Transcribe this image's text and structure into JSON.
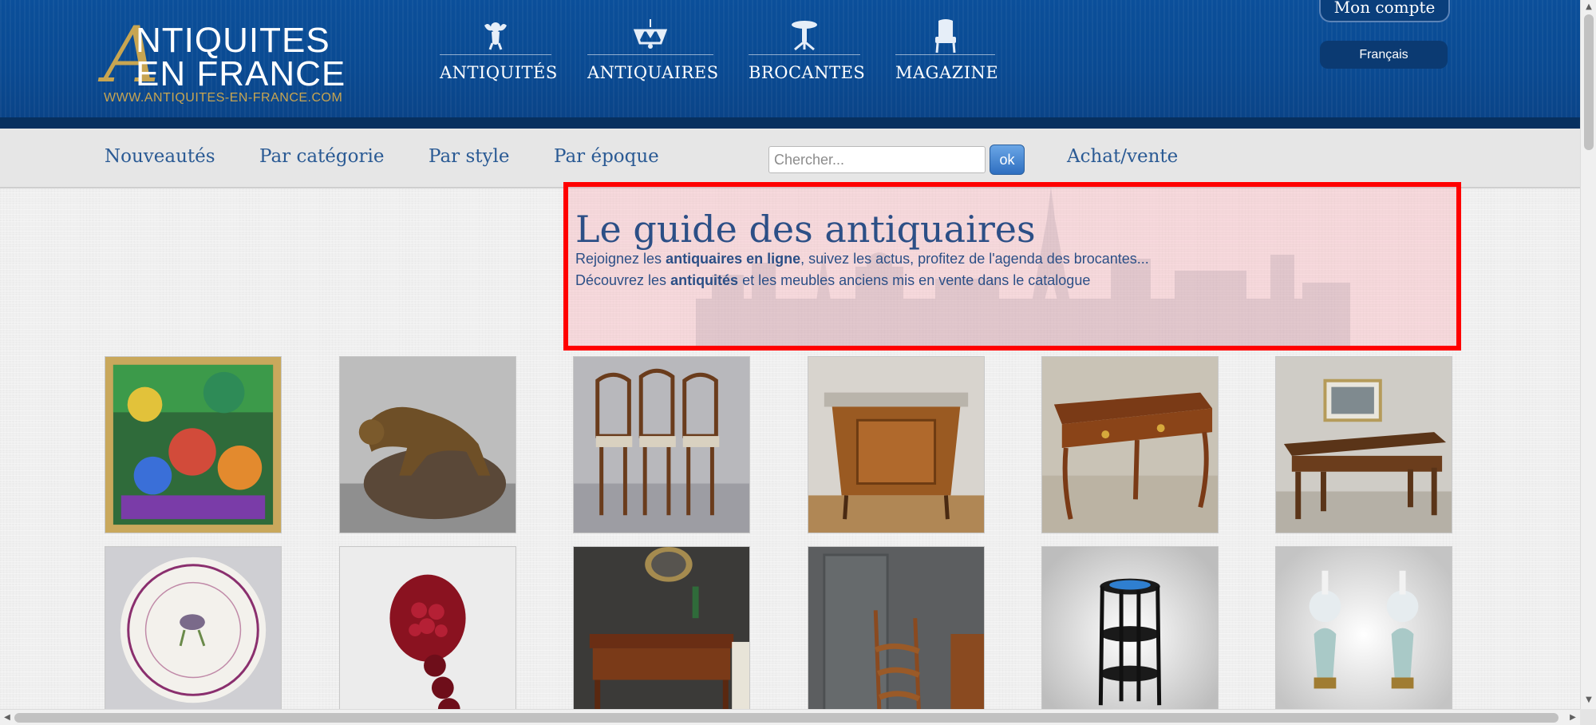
{
  "logo": {
    "big_letter": "A",
    "line1": "NTIQUITES",
    "line2": "EN FRANCE",
    "url": "WWW.ANTIQUITES-EN-FRANCE.COM"
  },
  "main_nav": [
    {
      "label": "ANTIQUITÉS",
      "icon": "cherub-icon"
    },
    {
      "label": "ANTIQUAIRES",
      "icon": "chandelier-icon"
    },
    {
      "label": "BROCANTES",
      "icon": "gueridon-table-icon"
    },
    {
      "label": "MAGAZINE",
      "icon": "armchair-icon"
    }
  ],
  "account": {
    "label": "Mon compte",
    "language": "Français"
  },
  "subnav": {
    "links": [
      "Nouveautés",
      "Par catégorie",
      "Par style",
      "Par époque"
    ],
    "search_placeholder": "Chercher...",
    "search_button": "ok",
    "buy_sell": "Achat/vente"
  },
  "intro": {
    "title": "Le guide des antiquaires",
    "line1_a": "Rejoignez les ",
    "line1_b": "antiquaires en ligne",
    "line1_c": ", suivez les actus, profitez de l'agenda des brocantes...",
    "line2_a": "Découvrez les ",
    "line2_b": "antiquités",
    "line2_c": " et les meubles anciens mis en vente dans le catalogue"
  },
  "products": [
    {
      "subject": "naive-painting"
    },
    {
      "subject": "bronze-panther-sculpture"
    },
    {
      "subject": "set-of-bistro-chairs"
    },
    {
      "subject": "demi-lune-cabinet"
    },
    {
      "subject": "louis-xv-desk"
    },
    {
      "subject": "farmhouse-table"
    },
    {
      "subject": "porcelain-bird-plate"
    },
    {
      "subject": "garnet-bracelet"
    },
    {
      "subject": "writing-desk-with-lamp"
    },
    {
      "subject": "library-step-ladder"
    },
    {
      "subject": "three-tier-side-table"
    },
    {
      "subject": "pair-of-oil-lamps"
    }
  ],
  "colors": {
    "header_blue": "#0b4f9a",
    "gold": "#c8a551",
    "link_blue": "#2a5a94",
    "highlight_border": "#ff0000"
  }
}
